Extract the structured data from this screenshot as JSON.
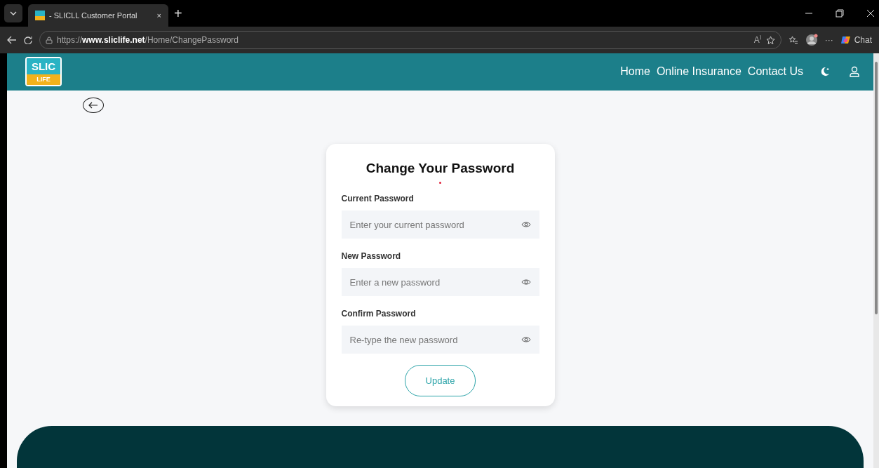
{
  "browser": {
    "tab_title": "- SLICLL Customer Portal",
    "tab_close": "×",
    "new_tab": "+",
    "url_prefix": "https://",
    "url_host": "www.sliclife.net",
    "url_path": "/Home/ChangePassword",
    "read_aloud": "A⁾",
    "more": "···",
    "chat": "Chat"
  },
  "header": {
    "logo_top": "SLIC",
    "logo_bottom": "LIFE",
    "nav": [
      {
        "label": "Home"
      },
      {
        "label": "Online Insurance"
      },
      {
        "label": "Contact Us"
      }
    ]
  },
  "form": {
    "title": "Change Your Password",
    "fields": [
      {
        "label": "Current Password",
        "placeholder": "Enter your current password"
      },
      {
        "label": "New Password",
        "placeholder": "Enter a new password"
      },
      {
        "label": "Confirm Password",
        "placeholder": "Re-type the new password"
      }
    ],
    "submit": "Update"
  }
}
